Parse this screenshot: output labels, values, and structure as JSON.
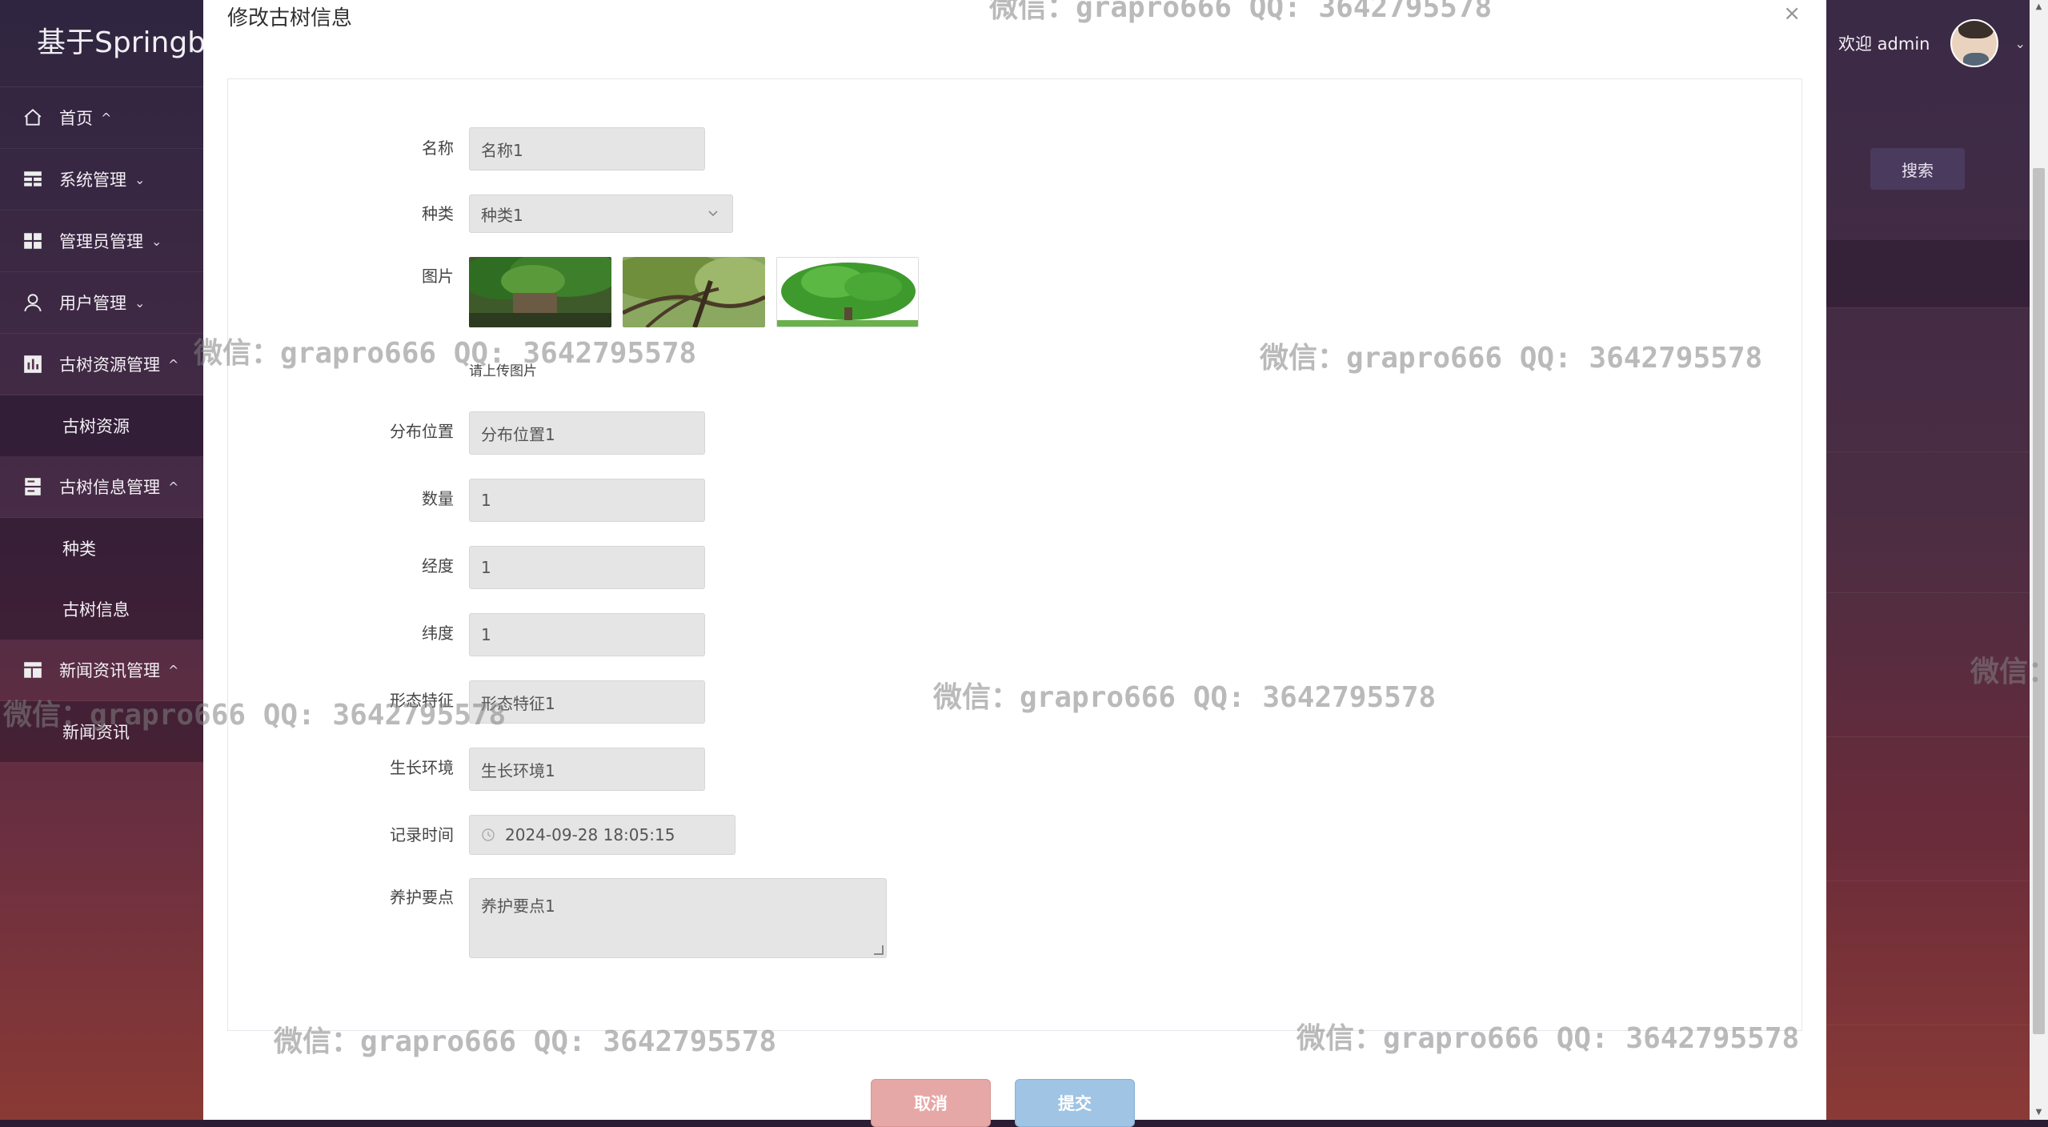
{
  "app": {
    "brand": "基于Springbo",
    "welcome": "欢迎 admin",
    "search_button": "搜索"
  },
  "sidebar": {
    "items": [
      {
        "label": "首页",
        "icon": "home-icon",
        "chev": "^"
      },
      {
        "label": "系统管理",
        "icon": "table-icon",
        "chev": "⌄"
      },
      {
        "label": "管理员管理",
        "icon": "grid-icon",
        "chev": "⌄"
      },
      {
        "label": "用户管理",
        "icon": "user-icon",
        "chev": "⌄"
      },
      {
        "label": "古树资源管理",
        "icon": "chart-icon",
        "chev": "^"
      },
      {
        "label": "古树资源",
        "sub": true
      },
      {
        "label": "古树信息管理",
        "icon": "server-icon",
        "chev": "^"
      },
      {
        "label": "种类",
        "sub": true
      },
      {
        "label": "古树信息",
        "sub": true
      },
      {
        "label": "新闻资讯管理",
        "icon": "layout-icon",
        "chev": "^"
      },
      {
        "label": "新闻资讯",
        "sub": true
      }
    ]
  },
  "modal": {
    "title": "修改古树信息",
    "close": "×",
    "fields": {
      "name": {
        "label": "名称",
        "value": "名称1"
      },
      "category": {
        "label": "种类",
        "value": "种类1"
      },
      "images": {
        "label": "图片",
        "tip": "请上传图片"
      },
      "location": {
        "label": "分布位置",
        "value": "分布位置1"
      },
      "quantity": {
        "label": "数量",
        "value": "1"
      },
      "longitude": {
        "label": "经度",
        "value": "1"
      },
      "latitude": {
        "label": "纬度",
        "value": "1"
      },
      "features": {
        "label": "形态特征",
        "value": "形态特征1"
      },
      "environment": {
        "label": "生长环境",
        "value": "生长环境1"
      },
      "record_time": {
        "label": "记录时间",
        "value": "2024-09-28 18:05:15"
      },
      "care": {
        "label": "养护要点",
        "value": "养护要点1"
      }
    },
    "cancel": "取消",
    "submit": "提交"
  },
  "watermark": "微信：grapro666 QQ: 3642795578",
  "watermark_partial": "微信：",
  "colors": {
    "cancel_button": "#e6a8a6",
    "submit_button": "#9fc4e4",
    "field_bg": "#e5e5e5"
  }
}
